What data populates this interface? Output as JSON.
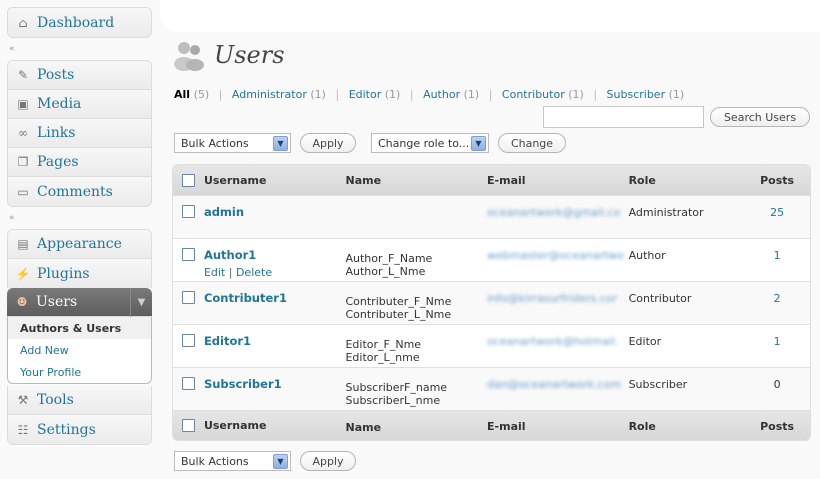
{
  "sidebar": {
    "dashboard": "Dashboard",
    "posts": "Posts",
    "media": "Media",
    "links": "Links",
    "pages": "Pages",
    "comments": "Comments",
    "appearance": "Appearance",
    "plugins": "Plugins",
    "users": "Users",
    "users_sub": [
      "Authors & Users",
      "Add New",
      "Your Profile"
    ],
    "tools": "Tools",
    "settings": "Settings",
    "collapse_glyph": "«"
  },
  "header": {
    "title": "Users"
  },
  "filters": [
    {
      "label": "All",
      "count": "(5)"
    },
    {
      "label": "Administrator",
      "count": "(1)"
    },
    {
      "label": "Editor",
      "count": "(1)"
    },
    {
      "label": "Author",
      "count": "(1)"
    },
    {
      "label": "Contributor",
      "count": "(1)"
    },
    {
      "label": "Subscriber",
      "count": "(1)"
    }
  ],
  "search": {
    "placeholder": "",
    "button": "Search Users"
  },
  "toolbar": {
    "bulk_actions": "Bulk Actions",
    "apply": "Apply",
    "change_role": "Change role to...",
    "change": "Change"
  },
  "table": {
    "columns": [
      "Username",
      "Name",
      "E-mail",
      "Role",
      "Posts"
    ],
    "rows": [
      {
        "username": "admin",
        "first": "",
        "last": "",
        "email": "oceanartwork@gmail.co",
        "role": "Administrator",
        "posts": "25",
        "actions": null
      },
      {
        "username": "Author1",
        "first": "Author_F_Name",
        "last": "Author_L_Nme",
        "email": "webmaster@oceanartwo",
        "role": "Author",
        "posts": "1",
        "actions": {
          "edit": "Edit",
          "delete": "Delete"
        }
      },
      {
        "username": "Contributer1",
        "first": "Contributer_F_Nme",
        "last": "Contributer_L_Nme",
        "email": "info@kirrasurfriders.cor",
        "role": "Contributor",
        "posts": "2",
        "actions": null
      },
      {
        "username": "Editor1",
        "first": "Editor_F_Nme",
        "last": "Editor_L_nme",
        "email": "oceanartwork@hotmail.",
        "role": "Editor",
        "posts": "1",
        "actions": null
      },
      {
        "username": "Subscriber1",
        "first": "SubscriberF_name",
        "last": "SubscriberL_nme",
        "email": "dan@oceanartwork.com",
        "role": "Subscriber",
        "posts": "0",
        "actions": null
      }
    ]
  },
  "colors": {
    "link": "#21759b",
    "current_menu": "#6a6a6a"
  }
}
